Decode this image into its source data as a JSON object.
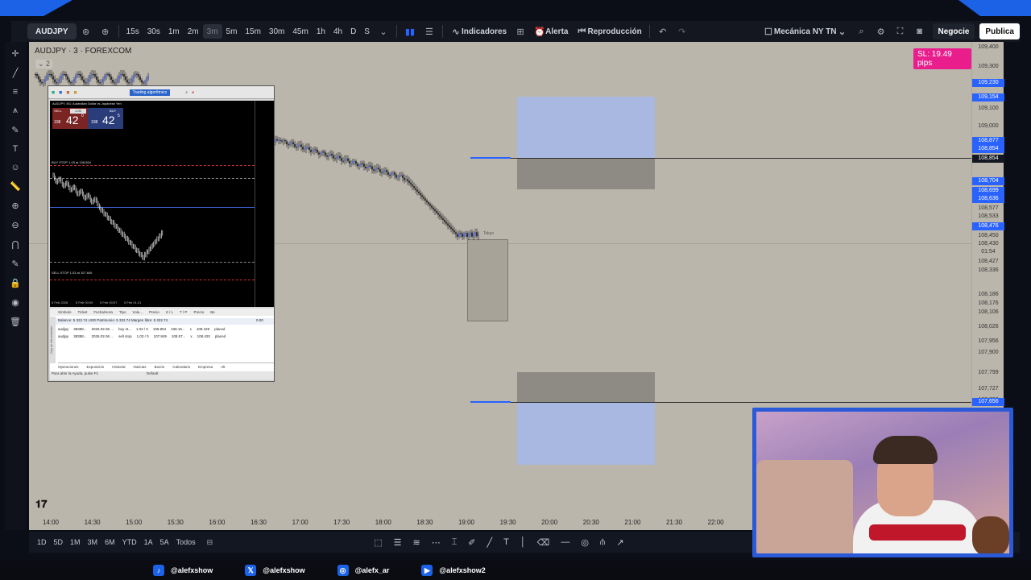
{
  "toolbar": {
    "symbol": "AUDJPY",
    "intervals": [
      "15s",
      "30s",
      "1m",
      "2m",
      "3m",
      "5m",
      "15m",
      "30m",
      "45m",
      "1h",
      "4h",
      "D",
      "S"
    ],
    "active_interval": "3m",
    "indicators": "Indicadores",
    "alert": "Alerta",
    "replay": "Reproducción",
    "layout_name": "Mecánica NY TN",
    "trade": "Negocie",
    "publish": "Publica"
  },
  "chart": {
    "title": "AUDJPY · 3 · FOREXCOM",
    "sl_badge": "SL: 19.49 pips",
    "session_label": "Tokyo",
    "price_labels": [
      {
        "text": "109,400",
        "style": "plain"
      },
      {
        "text": "109,300",
        "style": "plain"
      },
      {
        "text": "109,230",
        "style": "blue"
      },
      {
        "text": "109,154",
        "style": "blue"
      },
      {
        "text": "109,100",
        "style": "plain"
      },
      {
        "text": "109,000",
        "style": "plain"
      },
      {
        "text": "108,877",
        "style": "blue"
      },
      {
        "text": "108,854",
        "style": "blue"
      },
      {
        "text": "108,854",
        "style": "dark"
      },
      {
        "text": "108,704",
        "style": "blue"
      },
      {
        "text": "108,699",
        "style": "blue"
      },
      {
        "text": "108,636",
        "style": "blue"
      },
      {
        "text": "108,577",
        "style": "plain"
      },
      {
        "text": "108,533",
        "style": "plain"
      },
      {
        "text": "108,476",
        "style": "blue"
      },
      {
        "text": "108,450",
        "style": "plain"
      },
      {
        "text": "108,430",
        "style": "plain"
      },
      {
        "text": "01:54",
        "style": "plain"
      },
      {
        "text": "108,427",
        "style": "plain"
      },
      {
        "text": "108,336",
        "style": "plain"
      },
      {
        "text": "108,186",
        "style": "plain"
      },
      {
        "text": "108,176",
        "style": "plain"
      },
      {
        "text": "108,106",
        "style": "plain"
      },
      {
        "text": "108,026",
        "style": "plain"
      },
      {
        "text": "107,956",
        "style": "plain"
      },
      {
        "text": "107,900",
        "style": "plain"
      },
      {
        "text": "107,799",
        "style": "plain"
      },
      {
        "text": "107,727",
        "style": "plain"
      },
      {
        "text": "107,700",
        "style": "plain"
      },
      {
        "text": "107,656",
        "style": "blue"
      }
    ],
    "time_labels": [
      "14:00",
      "14:30",
      "15:00",
      "15:30",
      "16:00",
      "16:30",
      "17:00",
      "17:30",
      "18:00",
      "18:30",
      "19:00",
      "19:30",
      "20:00",
      "20:30",
      "21:00",
      "21:30",
      "22:00"
    ]
  },
  "mt": {
    "toolbar_tab": "Trading algorítmico",
    "chart_title": "AUDJPY, M1: Australian Dollar vs Japanese Yen",
    "sell_label": "SELL",
    "buy_label": "BUY",
    "lot": "1.00",
    "sell_price_small": "108",
    "sell_price_big": "42",
    "sell_sup": "0",
    "buy_price_small": "108",
    "buy_price_big": "42",
    "buy_sup": "5",
    "buy_stop_line": "BUY STOP 1.03 at 108.854",
    "sell_stop_line": "SELL STOP 1.03 at 107.849",
    "date_labels": [
      "5 Feb 2026",
      "5 Feb 00:09",
      "5 Feb 00:57",
      "5 Feb 01:21"
    ],
    "columns": [
      "Símbolo",
      "Ticket",
      "Fecha/Hora",
      "Tipo",
      "Volu...",
      "Precio",
      "S / L",
      "T / P",
      "Precio",
      "Be"
    ],
    "balance_line": "Balance: 5 322.74 USD  Patrimonio: 5 322.74  Margen libre: 5 322.74",
    "balance_value": "0.00",
    "orders": [
      {
        "symbol": "audjpy",
        "ticket": "38388...",
        "date": "2026.02.06 ...",
        "type": "buy st...",
        "vol": "1.03 / 0",
        "price": "108.854",
        "sl": "108.15...",
        "tp": "x",
        "cur": "108.429",
        "state": "placed"
      },
      {
        "symbol": "audjpy",
        "ticket": "38388...",
        "date": "2026.02.06 ...",
        "type": "sell stop",
        "vol": "1.03 / 0",
        "price": "107.849",
        "sl": "108.57...",
        "tp": "x",
        "cur": "108.420",
        "state": "placed"
      }
    ],
    "tabs": [
      "Operaciones",
      "Exposición",
      "Historial",
      "Noticias",
      "Buzón",
      "Calendario",
      "Empresa",
      "Alt"
    ],
    "side_label": "Caja de Herramientas",
    "status_left": "Para abrir la Ayuda, pulse F1",
    "status_right": "Default"
  },
  "bottombar": {
    "ranges": [
      "1D",
      "5D",
      "1M",
      "3M",
      "6M",
      "YTD",
      "1A",
      "5A",
      "Todos"
    ]
  },
  "footer": {
    "socials": [
      {
        "icon": "tiktok-icon",
        "handle": "@alefxshow"
      },
      {
        "icon": "x-icon",
        "handle": "@alefxshow"
      },
      {
        "icon": "instagram-icon",
        "handle": "@alefx_ar"
      },
      {
        "icon": "youtube-icon",
        "handle": "@alefxshow2"
      }
    ]
  },
  "colors": {
    "accent": "#2962ff",
    "sl_badge": "#e91e8c",
    "zone_blue": "#a9b8e0",
    "zone_gray": "#8e8a84",
    "chart_bg": "#bbb6ac",
    "frame_blue": "#1c62e6"
  }
}
